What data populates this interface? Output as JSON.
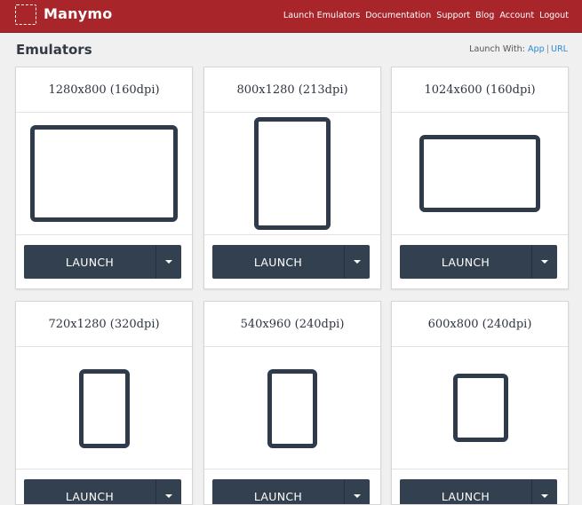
{
  "app": {
    "brand": "Manymo"
  },
  "nav": {
    "items": [
      {
        "label": "Launch Emulators"
      },
      {
        "label": "Documentation"
      },
      {
        "label": "Support"
      },
      {
        "label": "Blog"
      },
      {
        "label": "Account"
      },
      {
        "label": "Logout"
      }
    ]
  },
  "page": {
    "title": "Emulators",
    "launch_with_label": "Launch With:",
    "launch_with_options": [
      "App",
      "URL"
    ],
    "separator": "|"
  },
  "emulators": [
    {
      "label": "1280x800 (160dpi)",
      "launch_label": "LAUNCH"
    },
    {
      "label": "800x1280 (213dpi)",
      "launch_label": "LAUNCH"
    },
    {
      "label": "1024x600 (160dpi)",
      "launch_label": "LAUNCH"
    },
    {
      "label": "720x1280 (320dpi)",
      "launch_label": "LAUNCH"
    },
    {
      "label": "540x960 (240dpi)",
      "launch_label": "LAUNCH"
    },
    {
      "label": "600x800 (240dpi)",
      "launch_label": "LAUNCH"
    }
  ],
  "colors": {
    "header_bg": "#a8252a",
    "button_bg": "#33404f",
    "link": "#2a8bd6",
    "device_frame": "#2f3a4a"
  }
}
